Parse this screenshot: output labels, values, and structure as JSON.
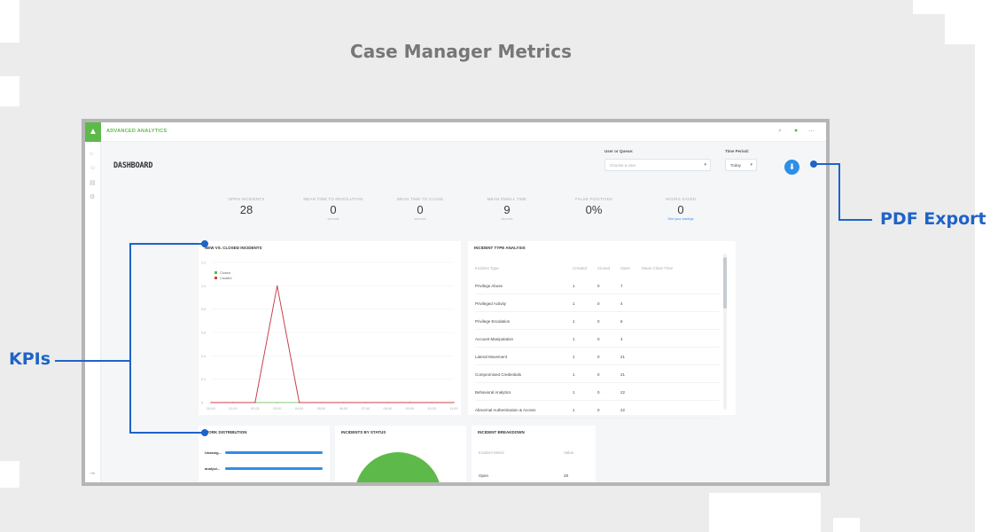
{
  "page_title": "Case Manager Metrics",
  "annotations": {
    "kpis": "KPIs",
    "pdf_export": "PDF Export"
  },
  "app": {
    "brand": "ADVANCED ANALYTICS",
    "logo_icon": "triangle-logo-icon",
    "topbar_icons": [
      "search-icon",
      "bell-icon",
      "more-icon"
    ],
    "nav_icons": [
      "home-icon",
      "user-icon",
      "document-icon",
      "settings-icon",
      "collapse-icon"
    ],
    "accent_color": "#5dba4a",
    "primary_color": "#2d8fe8"
  },
  "dashboard": {
    "title": "DASHBOARD",
    "user_queue_label": "User or Queue:",
    "user_queue_placeholder": "Choose a user",
    "time_period_label": "Time Period:",
    "time_period_value": "Today",
    "export_icon": "download-icon"
  },
  "kpis": [
    {
      "label": "OPEN INCIDENTS",
      "value": "28",
      "unit": "",
      "link": ""
    },
    {
      "label": "MEAN TIME TO RESOLUTION",
      "value": "0",
      "unit": "seconds",
      "link": ""
    },
    {
      "label": "MEAN TIME TO CLOSE",
      "value": "0",
      "unit": "seconds",
      "link": ""
    },
    {
      "label": "MEAN DWELL TIME",
      "value": "9",
      "unit": "seconds",
      "link": ""
    },
    {
      "label": "FALSE POSITIVES",
      "value": "0%",
      "unit": "",
      "link": ""
    },
    {
      "label": "HOURS SAVED",
      "value": "0",
      "unit": "",
      "link": "See your savings"
    }
  ],
  "new_closed": {
    "title": "NEW VS. CLOSED INCIDENTS",
    "chart_data": {
      "type": "line",
      "title": "NEW VS. CLOSED INCIDENTS",
      "x": [
        "00:00",
        "01:00",
        "02:00",
        "03:00",
        "04:00",
        "05:00",
        "06:00",
        "07:00",
        "08:00",
        "09:00",
        "10:00",
        "11:00"
      ],
      "series": [
        {
          "name": "Closed",
          "color": "#5dba4a",
          "values": [
            0,
            0,
            0,
            0,
            0,
            0,
            0,
            0,
            0,
            0,
            0,
            0
          ]
        },
        {
          "name": "Created",
          "color": "#c8414b",
          "values": [
            0,
            0,
            0,
            1,
            0,
            0,
            0,
            0,
            0,
            0,
            0,
            0
          ]
        }
      ],
      "yticks": [
        "1.2",
        "1.0",
        "0.8",
        "0.6",
        "0.4",
        "0.2",
        "0"
      ],
      "ylim": [
        0,
        1.2
      ],
      "legend": "top-left",
      "grid": true
    }
  },
  "incident_types": {
    "title": "INCIDENT TYPE ANALYSIS",
    "columns": [
      "Incident Type",
      "Created",
      "Closed",
      "Open",
      "Mean Close Time"
    ],
    "rows": [
      [
        "Privilege Abuse",
        "1",
        "0",
        "7",
        ""
      ],
      [
        "Privileged Activity",
        "1",
        "0",
        "4",
        ""
      ],
      [
        "Privilege Escalation",
        "1",
        "0",
        "6",
        ""
      ],
      [
        "Account Manipulation",
        "1",
        "0",
        "4",
        ""
      ],
      [
        "Lateral Movement",
        "1",
        "0",
        "21",
        ""
      ],
      [
        "Compromised Credentials",
        "1",
        "0",
        "21",
        ""
      ],
      [
        "Behavioral Analytics",
        "1",
        "0",
        "22",
        ""
      ],
      [
        "Abnormal Authentication & Access",
        "1",
        "0",
        "22",
        ""
      ]
    ]
  },
  "work_distribution": {
    "title": "WORK DISTRIBUTION",
    "rows": [
      {
        "label": "Unassig...",
        "share": 1.0
      },
      {
        "label": "analyst...",
        "share": 1.0
      }
    ]
  },
  "incidents_by_status": {
    "title": "INCIDENTS BY STATUS",
    "chart_data": {
      "type": "pie",
      "slices": [
        {
          "color": "#5dba4a",
          "share": 1.0
        }
      ]
    }
  },
  "incident_breakdown": {
    "title": "INCIDENT BREAKDOWN",
    "columns": [
      "Incident Metric",
      "Value"
    ],
    "rows": [
      [
        "Open",
        "28"
      ]
    ]
  }
}
